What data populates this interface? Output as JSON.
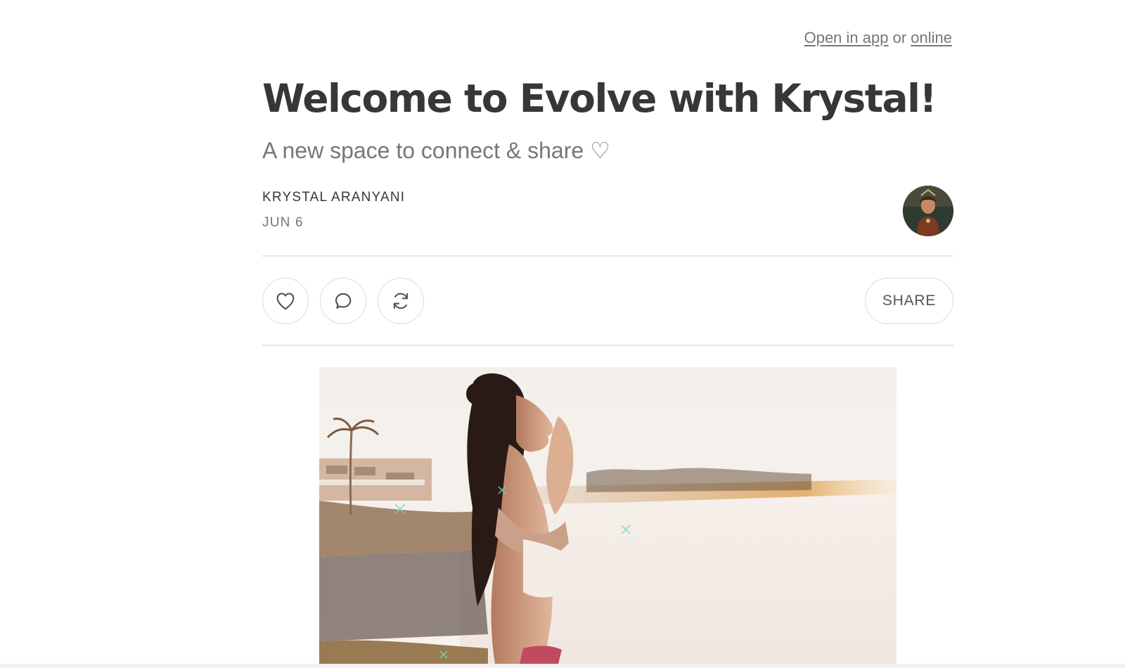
{
  "header": {
    "open_in_app_label": "Open in app",
    "or_text": "or",
    "online_label": "online"
  },
  "post": {
    "title": "Welcome to Evolve with Krystal!",
    "subtitle": "A new space to connect & share ♡",
    "author": "KRYSTAL ARANYANI",
    "date": "JUN 6"
  },
  "actions": {
    "like_icon": "heart-icon",
    "comment_icon": "comment-bubble-icon",
    "restack_icon": "restack-icon",
    "share_label": "SHARE"
  },
  "colors": {
    "text": "#363737",
    "muted": "#777777",
    "divider": "#e6e6e6"
  }
}
